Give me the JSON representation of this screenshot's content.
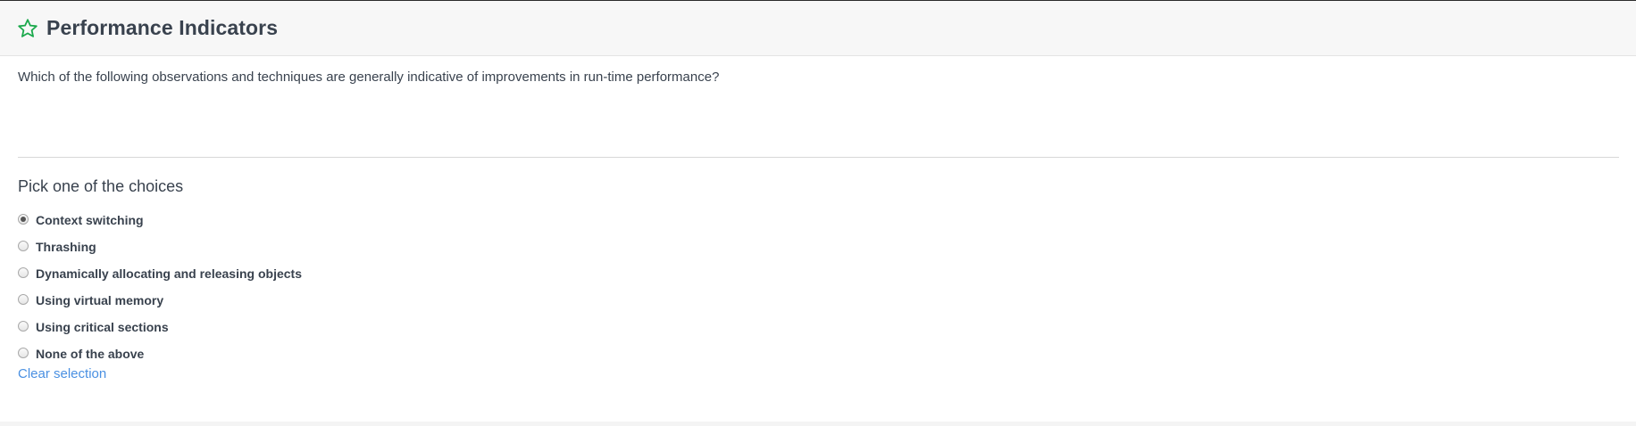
{
  "header": {
    "title": "Performance Indicators",
    "icon": "star-outline-icon",
    "icon_color": "#1ba94c"
  },
  "question": {
    "text": "Which of the following observations and techniques are generally indicative of improvements in run-time performance?"
  },
  "choices": {
    "heading": "Pick one of the choices",
    "selected_index": 0,
    "items": [
      {
        "label": "Context switching",
        "checked": true
      },
      {
        "label": "Thrashing",
        "checked": false
      },
      {
        "label": "Dynamically allocating and releasing objects",
        "checked": false
      },
      {
        "label": "Using virtual memory",
        "checked": false
      },
      {
        "label": "Using critical sections",
        "checked": false
      },
      {
        "label": "None of the above",
        "checked": false
      }
    ],
    "clear_label": "Clear selection"
  },
  "colors": {
    "text": "#39424e",
    "link": "#4a90e2",
    "header_bg": "#f7f7f7"
  }
}
